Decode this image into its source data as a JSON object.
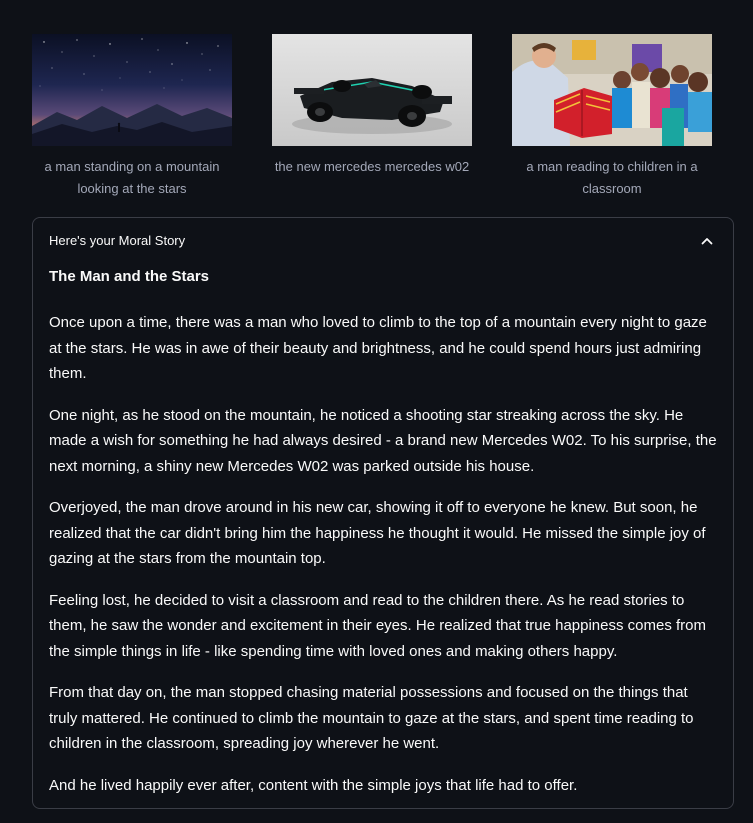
{
  "gallery": [
    {
      "caption": "a man standing on a mountain looking at the stars",
      "image": "night-mountain-stargazer"
    },
    {
      "caption": "the new mercedes mercedes w02",
      "image": "mercedes-f1-car"
    },
    {
      "caption": "a man reading to children in a classroom",
      "image": "man-reading-to-children"
    }
  ],
  "expander": {
    "title": "Here's your Moral Story",
    "chevron_icon": "chevron-up-icon"
  },
  "story": {
    "title": "The Man and the Stars",
    "paragraphs": [
      "Once upon a time, there was a man who loved to climb to the top of a mountain every night to gaze at the stars. He was in awe of their beauty and brightness, and he could spend hours just admiring them.",
      "One night, as he stood on the mountain, he noticed a shooting star streaking across the sky. He made a wish for something he had always desired - a brand new Mercedes W02. To his surprise, the next morning, a shiny new Mercedes W02 was parked outside his house.",
      "Overjoyed, the man drove around in his new car, showing it off to everyone he knew. But soon, he realized that the car didn't bring him the happiness he thought it would. He missed the simple joy of gazing at the stars from the mountain top.",
      "Feeling lost, he decided to visit a classroom and read to the children there. As he read stories to them, he saw the wonder and excitement in their eyes. He realized that true happiness comes from the simple things in life - like spending time with loved ones and making others happy.",
      "From that day on, the man stopped chasing material possessions and focused on the things that truly mattered. He continued to climb the mountain to gaze at the stars, and spent time reading to children in the classroom, spreading joy wherever he went.",
      "And he lived happily ever after, content with the simple joys that life had to offer."
    ]
  },
  "colors": {
    "background": "#0e1117",
    "text": "#fafafa",
    "caption": "#a3a8b8",
    "border": "#3a3d46"
  }
}
